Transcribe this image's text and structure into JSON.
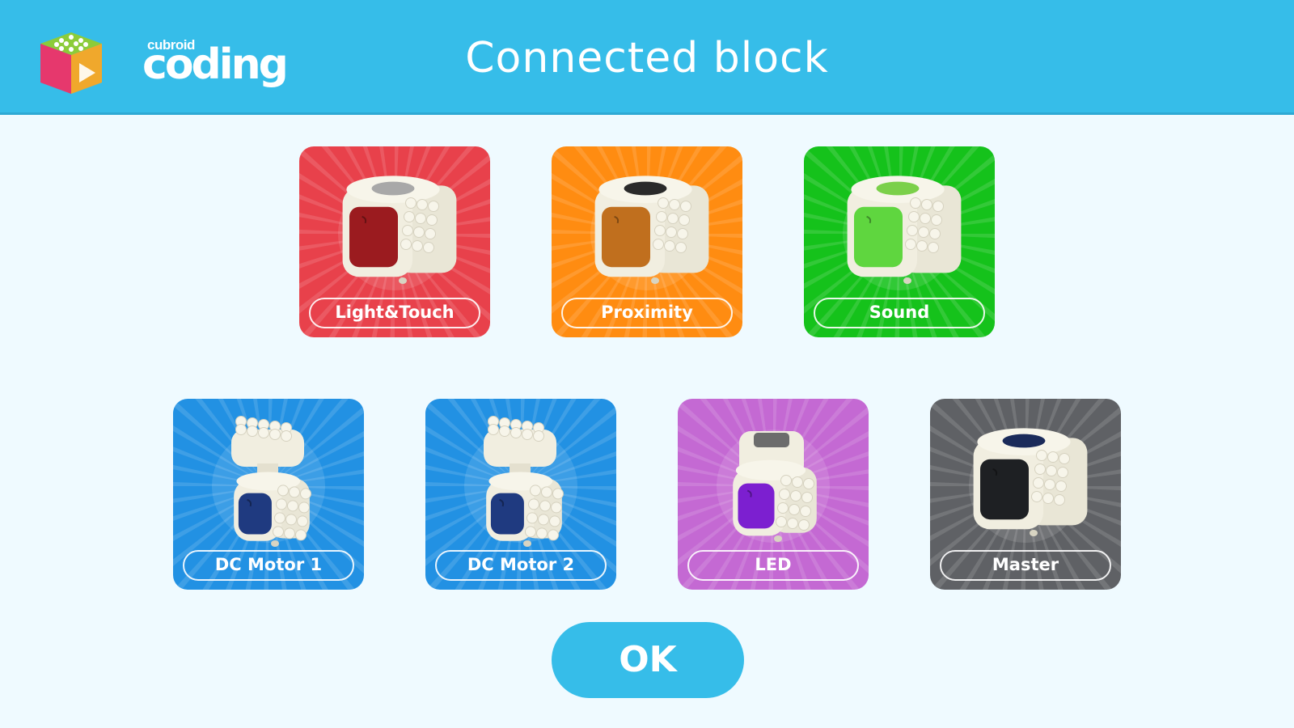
{
  "header": {
    "logo_small": "cubroid",
    "logo_big": "coding",
    "title": "Connected block"
  },
  "blocks": [
    {
      "label": "Light&Touch",
      "color": "#e8414b",
      "face": "#9b1b1f",
      "top": "#a8a8a8"
    },
    {
      "label": "Proximity",
      "color": "#ff8c11",
      "face": "#c06f1e",
      "top": "#2a2a2a"
    },
    {
      "label": "Sound",
      "color": "#15c21b",
      "face": "#5fd63f",
      "top": "#7bd04a"
    },
    {
      "label": "DC Motor 1",
      "color": "#2291e3",
      "face": "#1f3a80"
    },
    {
      "label": "DC Motor 2",
      "color": "#2291e3",
      "face": "#1f3a80"
    },
    {
      "label": "LED",
      "color": "#c469d3",
      "face": "#7c1fd0"
    },
    {
      "label": "Master",
      "color": "#5f6165",
      "face": "#1e2023",
      "top": "#1b2b5a"
    }
  ],
  "ok_label": "OK",
  "colors": {
    "header": "#36bde9",
    "background": "#effaff"
  }
}
